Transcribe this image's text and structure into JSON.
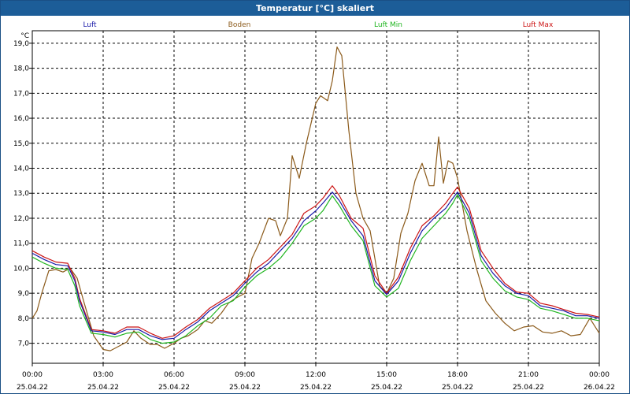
{
  "window": {
    "title": "Temperatur [°C] skaliert"
  },
  "chart_data": {
    "type": "line",
    "title": "Temperatur [°C] skaliert",
    "y_unit": "°C",
    "ylim": [
      6.2,
      19.5
    ],
    "y_ticks": [
      "7,0",
      "8,0",
      "9,0",
      "10,0",
      "11,0",
      "12,0",
      "13,0",
      "14,0",
      "15,0",
      "16,0",
      "17,0",
      "18,0",
      "19,0"
    ],
    "x_range_hours": [
      0,
      24
    ],
    "x_ticks": [
      {
        "time": "00:00",
        "date": "25.04.22"
      },
      {
        "time": "03:00",
        "date": "25.04.22"
      },
      {
        "time": "06:00",
        "date": "25.04.22"
      },
      {
        "time": "09:00",
        "date": "25.04.22"
      },
      {
        "time": "12:00",
        "date": "25.04.22"
      },
      {
        "time": "15:00",
        "date": "25.04.22"
      },
      {
        "time": "18:00",
        "date": "25.04.22"
      },
      {
        "time": "21:00",
        "date": "25.04.22"
      },
      {
        "time": "00:00",
        "date": "26.04.22"
      }
    ],
    "grid": true,
    "legend_position": "top",
    "series": [
      {
        "name": "Luft",
        "color": "#1a1aa8",
        "x": [
          0,
          0.5,
          1,
          1.5,
          1.8,
          2,
          2.5,
          3,
          3.5,
          4,
          4.5,
          5,
          5.5,
          6,
          6.5,
          7,
          7.5,
          8,
          8.5,
          9,
          9.5,
          10,
          10.5,
          11,
          11.5,
          12,
          12.3,
          12.7,
          13,
          13.5,
          14,
          14.5,
          15,
          15.5,
          16,
          16.5,
          17,
          17.5,
          17.8,
          18,
          18.5,
          19,
          19.5,
          20,
          20.5,
          21,
          21.5,
          22,
          22.5,
          23,
          23.5,
          24
        ],
        "y": [
          10.6,
          10.35,
          10.15,
          10.1,
          9.5,
          8.7,
          7.5,
          7.45,
          7.35,
          7.55,
          7.55,
          7.3,
          7.15,
          7.2,
          7.55,
          7.85,
          8.3,
          8.6,
          8.9,
          9.4,
          9.85,
          10.2,
          10.7,
          11.2,
          11.9,
          12.3,
          12.6,
          13.05,
          12.7,
          11.9,
          11.3,
          9.5,
          8.95,
          9.5,
          10.6,
          11.5,
          12.0,
          12.4,
          12.8,
          13.05,
          12.2,
          10.5,
          9.8,
          9.3,
          9.0,
          8.9,
          8.5,
          8.4,
          8.3,
          8.1,
          8.1,
          8.0
        ]
      },
      {
        "name": "Boden",
        "color": "#8b5a1a",
        "x": [
          0,
          0.2,
          0.4,
          0.7,
          1,
          1.3,
          1.6,
          1.9,
          2.2,
          2.6,
          3,
          3.3,
          3.6,
          4,
          4.3,
          4.6,
          5,
          5.3,
          5.6,
          6,
          6.3,
          6.6,
          7,
          7.3,
          7.6,
          8,
          8.3,
          8.6,
          9,
          9.3,
          9.6,
          10,
          10.3,
          10.5,
          10.8,
          11,
          11.3,
          11.6,
          12,
          12.2,
          12.5,
          12.7,
          12.9,
          13.1,
          13.4,
          13.7,
          14,
          14.3,
          14.7,
          15,
          15.3,
          15.6,
          15.9,
          16.2,
          16.5,
          16.8,
          17,
          17.2,
          17.4,
          17.6,
          17.8,
          18,
          18.4,
          18.8,
          19.2,
          19.6,
          20,
          20.4,
          20.8,
          21.2,
          21.6,
          22,
          22.4,
          22.8,
          23.2,
          23.6,
          24
        ],
        "y": [
          8.0,
          8.3,
          9.0,
          9.9,
          9.95,
          9.85,
          10.0,
          9.6,
          8.6,
          7.3,
          6.75,
          6.7,
          6.85,
          7.05,
          7.5,
          7.2,
          6.95,
          6.95,
          6.8,
          7.0,
          7.2,
          7.3,
          7.55,
          7.9,
          7.8,
          8.2,
          8.6,
          8.8,
          9.0,
          10.4,
          11.0,
          12.0,
          11.9,
          11.3,
          12.0,
          14.5,
          13.6,
          15.0,
          16.6,
          16.9,
          16.7,
          17.5,
          18.85,
          18.5,
          15.5,
          13.0,
          12.0,
          11.5,
          9.3,
          9.0,
          9.6,
          11.4,
          12.2,
          13.5,
          14.2,
          13.3,
          13.3,
          15.25,
          13.4,
          14.3,
          14.2,
          13.6,
          11.5,
          10.0,
          8.7,
          8.2,
          7.8,
          7.5,
          7.65,
          7.7,
          7.45,
          7.4,
          7.5,
          7.3,
          7.35,
          8.0,
          7.4
        ]
      },
      {
        "name": "Luft Min",
        "color": "#1fb51f",
        "x": [
          0,
          0.5,
          1,
          1.5,
          1.8,
          2,
          2.5,
          3,
          3.5,
          4,
          4.5,
          5,
          5.5,
          6,
          6.5,
          7,
          7.5,
          8,
          8.5,
          9,
          9.5,
          10,
          10.5,
          11,
          11.5,
          12,
          12.3,
          12.7,
          13,
          13.5,
          14,
          14.5,
          15,
          15.5,
          16,
          16.5,
          17,
          17.5,
          17.8,
          18,
          18.5,
          19,
          19.5,
          20,
          20.5,
          21,
          21.5,
          22,
          22.5,
          23,
          23.5,
          24
        ],
        "y": [
          10.45,
          10.2,
          10.0,
          9.95,
          9.3,
          8.5,
          7.4,
          7.35,
          7.25,
          7.4,
          7.45,
          7.15,
          7.0,
          7.05,
          7.3,
          7.7,
          8.0,
          8.5,
          8.7,
          9.25,
          9.7,
          10.0,
          10.4,
          11.0,
          11.7,
          12.0,
          12.3,
          12.9,
          12.5,
          11.7,
          11.1,
          9.3,
          8.85,
          9.2,
          10.3,
          11.2,
          11.7,
          12.2,
          12.6,
          12.95,
          12.0,
          10.3,
          9.6,
          9.1,
          8.85,
          8.75,
          8.4,
          8.3,
          8.15,
          8.0,
          8.0,
          7.9
        ]
      },
      {
        "name": "Luft Max",
        "color": "#cc1414",
        "x": [
          0,
          0.5,
          1,
          1.5,
          1.8,
          2,
          2.5,
          3,
          3.5,
          4,
          4.5,
          5,
          5.5,
          6,
          6.5,
          7,
          7.5,
          8,
          8.5,
          9,
          9.5,
          10,
          10.5,
          11,
          11.5,
          12,
          12.3,
          12.7,
          13,
          13.5,
          14,
          14.5,
          15,
          15.5,
          16,
          16.5,
          17,
          17.5,
          17.8,
          18,
          18.5,
          19,
          19.5,
          20,
          20.5,
          21,
          21.5,
          22,
          22.5,
          23,
          23.5,
          24
        ],
        "y": [
          10.7,
          10.45,
          10.25,
          10.2,
          9.6,
          8.8,
          7.55,
          7.5,
          7.4,
          7.65,
          7.65,
          7.4,
          7.2,
          7.3,
          7.65,
          7.95,
          8.4,
          8.7,
          9.0,
          9.5,
          10.0,
          10.35,
          10.85,
          11.35,
          12.2,
          12.5,
          12.8,
          13.3,
          12.9,
          12.0,
          11.6,
          9.7,
          9.0,
          9.65,
          10.8,
          11.7,
          12.1,
          12.6,
          13.0,
          13.25,
          12.4,
          10.7,
          10.0,
          9.4,
          9.05,
          9.0,
          8.6,
          8.5,
          8.35,
          8.2,
          8.15,
          8.05
        ]
      }
    ]
  }
}
